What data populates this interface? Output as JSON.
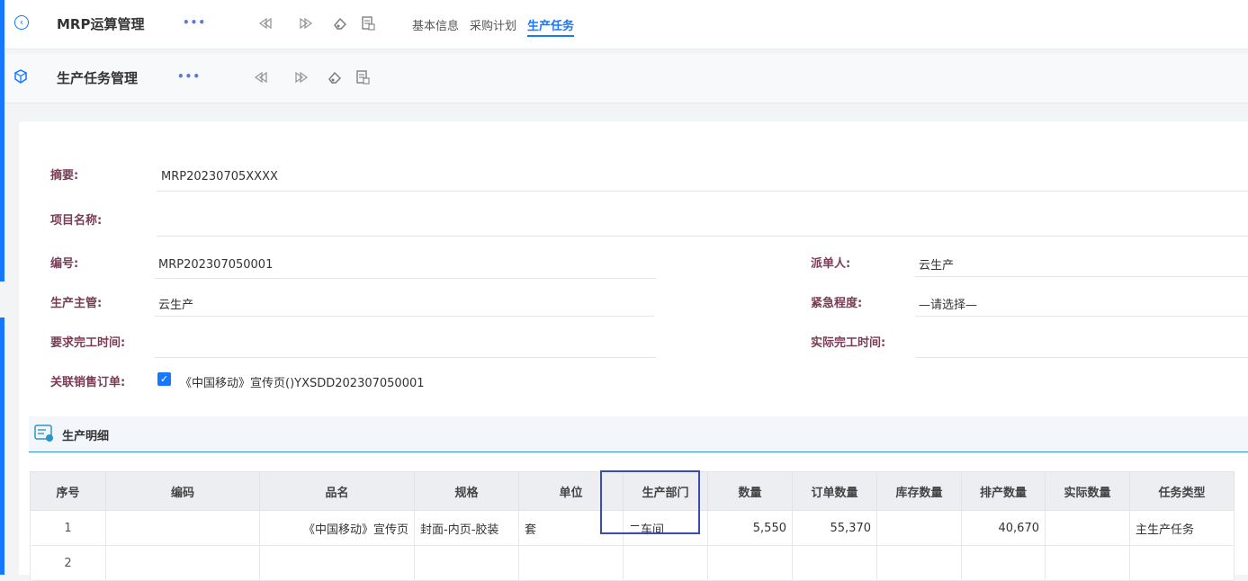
{
  "topbar": {
    "title": "MRP运算管理",
    "more": "•••",
    "tabs": [
      {
        "label": "基本信息"
      },
      {
        "label": "采购计划"
      },
      {
        "label": "生产任务"
      }
    ],
    "active_tab": 2
  },
  "subbar": {
    "title": "生产任务管理",
    "more": "•••"
  },
  "icons": {
    "back": "back-circle-icon",
    "cube": "cube-icon",
    "prev": "prev-icon",
    "next": "next-icon",
    "eraser": "eraser-icon",
    "doc": "document-icon"
  },
  "form": {
    "summary": {
      "label": "摘要:",
      "value": "MRP20230705XXXX"
    },
    "project": {
      "label": "项目名称:",
      "value": ""
    },
    "code": {
      "label": "编号:",
      "value": "MRP202307050001"
    },
    "dispatcher": {
      "label": "派单人:",
      "value": "云生产"
    },
    "supervisor": {
      "label": "生产主管:",
      "value": "云生产"
    },
    "urgency": {
      "label": "紧急程度:",
      "value": "—请选择—"
    },
    "required_finish": {
      "label": "要求完工时间:",
      "value": ""
    },
    "actual_finish": {
      "label": "实际完工时间:",
      "value": ""
    },
    "sales_order": {
      "label": "关联销售订单:",
      "value": "《中国移动》宣传页()YXSDD202307050001",
      "checked": true
    }
  },
  "section": {
    "title": "生产明细"
  },
  "table": {
    "headers": [
      "序号",
      "编码",
      "品名",
      "规格",
      "单位",
      "生产部门",
      "数量",
      "订单数量",
      "库存数量",
      "排产数量",
      "实际数量",
      "任务类型"
    ],
    "rows": [
      [
        "1",
        "",
        "《中国移动》宣传页",
        "封面-内页-胶装",
        "套",
        "二车间",
        "5,550",
        "55,370",
        "",
        "40,670",
        "",
        "主生产任务"
      ],
      [
        "2",
        "",
        "",
        "",
        "",
        "",
        "",
        "",
        "",
        "",
        "",
        ""
      ]
    ]
  },
  "colors": {
    "accent": "#1677ff",
    "label": "#7a3b54",
    "highlight": "#3b4bb0"
  }
}
